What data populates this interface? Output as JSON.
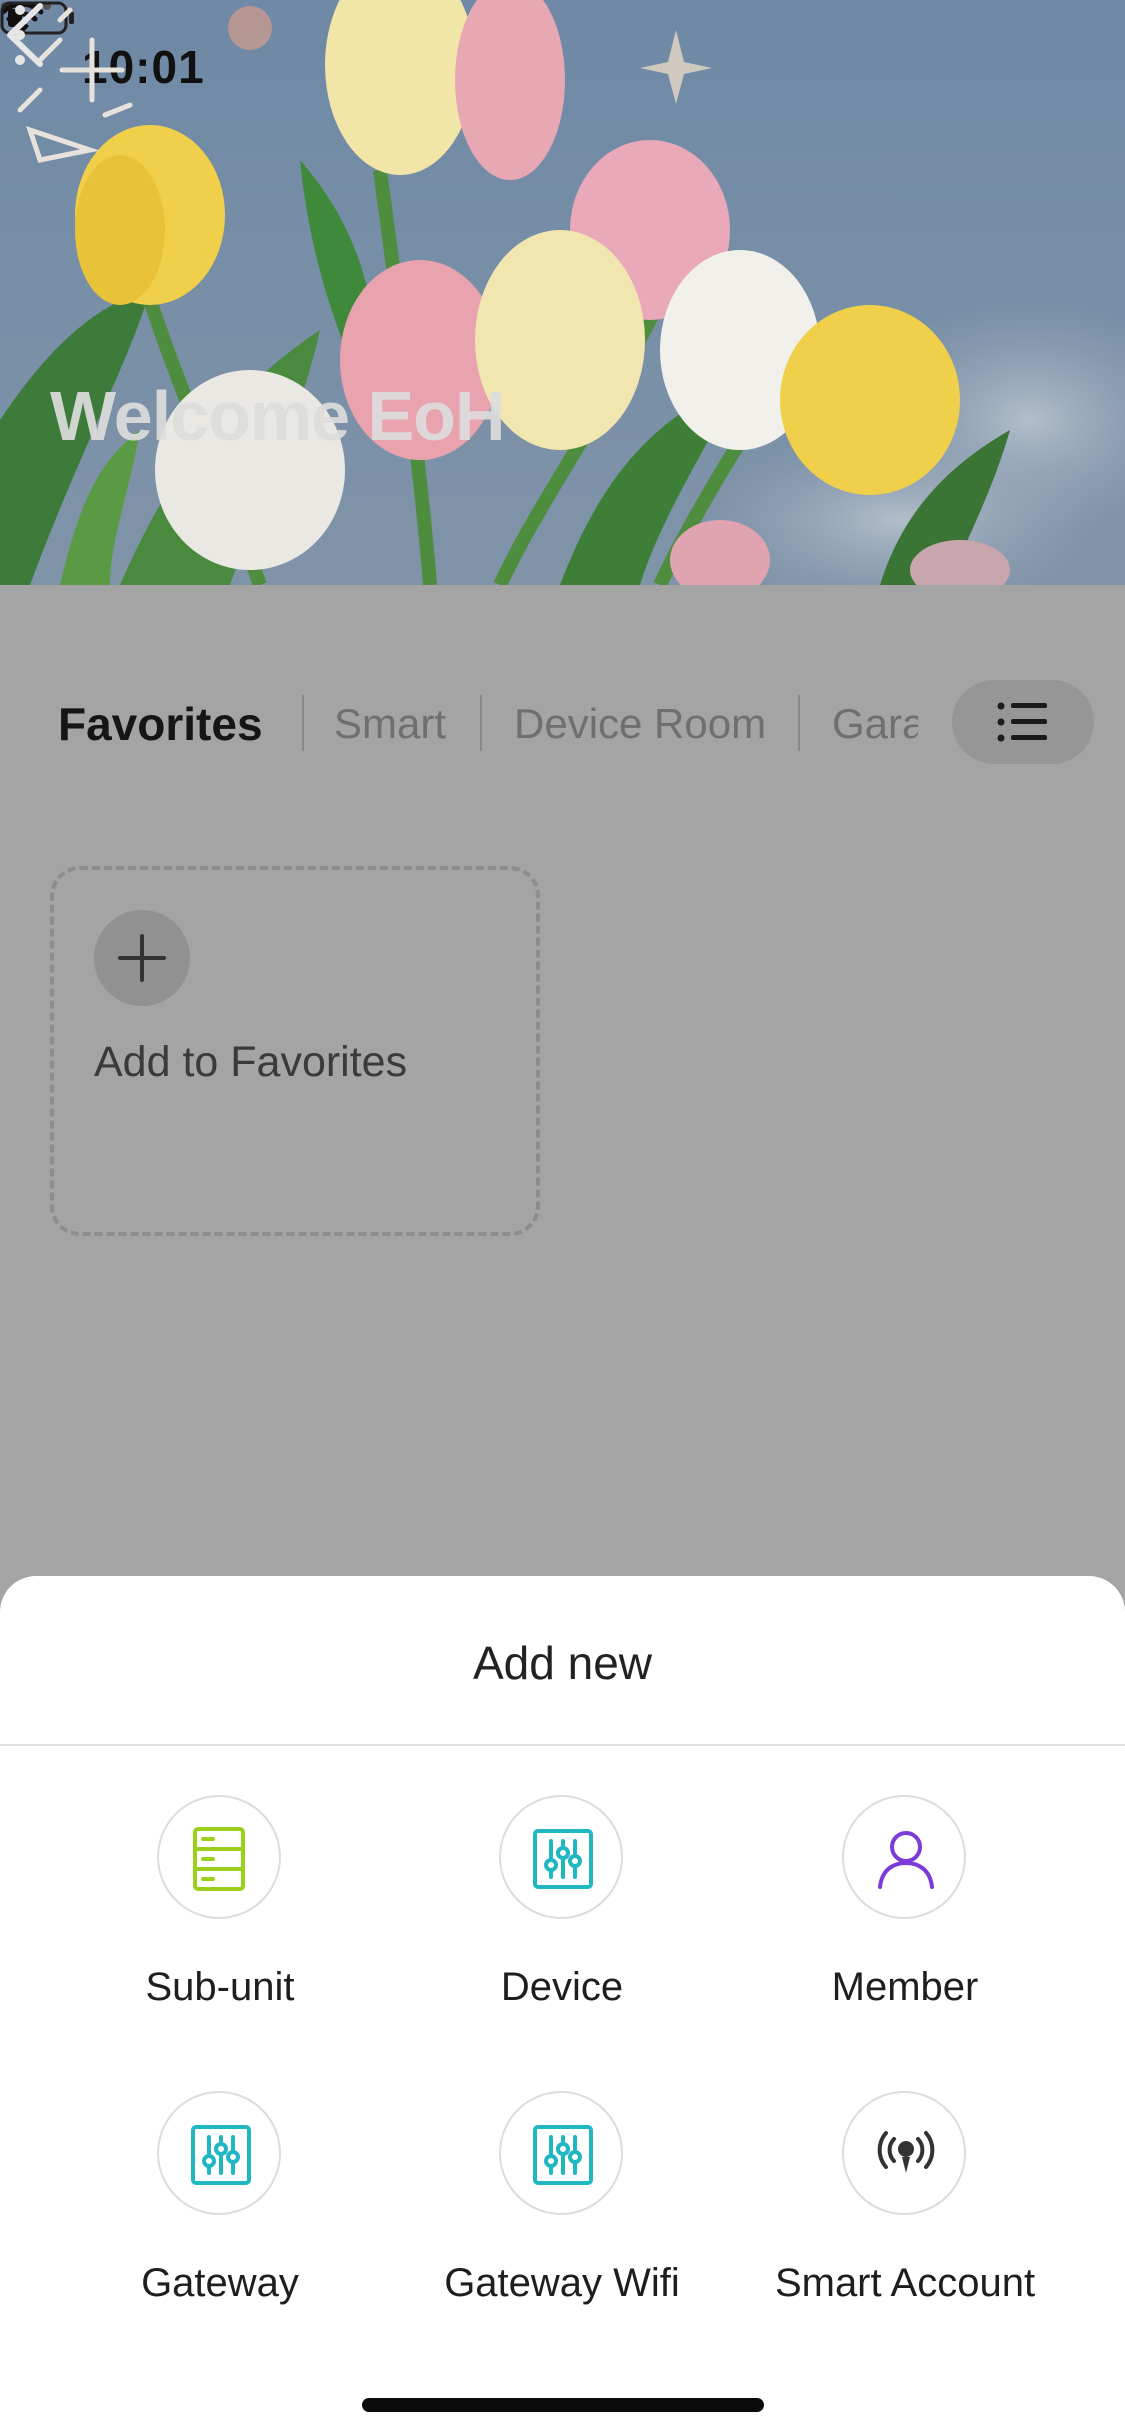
{
  "status_bar": {
    "time": "10:01",
    "wifi_icon": "wifi-icon",
    "battery_icon": "battery-low-icon"
  },
  "header": {
    "back_icon": "chevron-left-icon",
    "action_icon": "ai-sparkle-add-icon",
    "more_icon": "more-vertical-icon",
    "title": "Welcome EoH"
  },
  "tabs": [
    {
      "label": "Favorites",
      "active": true
    },
    {
      "label": "Smart",
      "active": false
    },
    {
      "label": "Device Room",
      "active": false
    },
    {
      "label": "Gara",
      "active": false
    }
  ],
  "list_button_icon": "list-icon",
  "favorites_card": {
    "add_label": "Add to Favorites",
    "icon": "plus-icon"
  },
  "sheet": {
    "title": "Add new",
    "options": [
      {
        "label": "Sub-unit",
        "icon": "server-rack-icon",
        "color": "#9ccf1c"
      },
      {
        "label": "Device",
        "icon": "sliders-device-icon",
        "color": "#1fb7c2"
      },
      {
        "label": "Member",
        "icon": "user-icon",
        "color": "#7c3bd9"
      },
      {
        "label": "Gateway",
        "icon": "sliders-gateway-icon",
        "color": "#1fb7c2"
      },
      {
        "label": "Gateway Wifi",
        "icon": "sliders-gateway-wifi-icon",
        "color": "#1fb7c2"
      },
      {
        "label": "Smart Account",
        "icon": "broadcast-icon",
        "color": "#333333"
      }
    ]
  }
}
